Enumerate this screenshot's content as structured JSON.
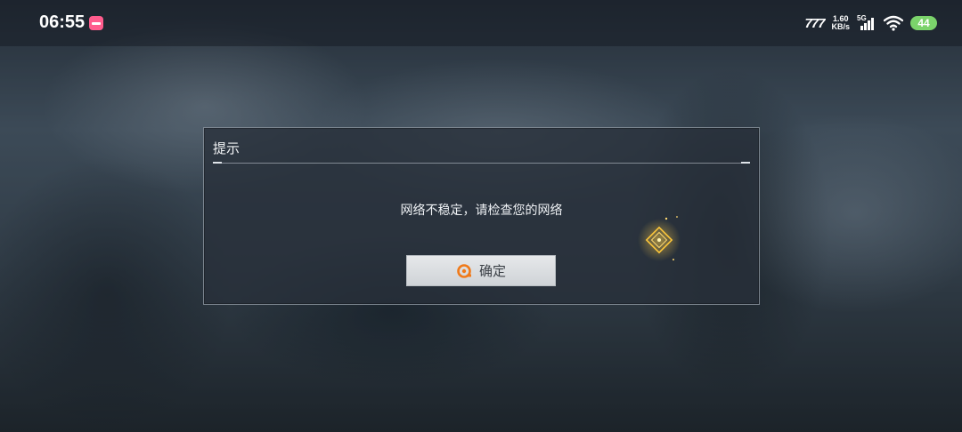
{
  "status_bar": {
    "time": "06:55",
    "carrier_logo": "777",
    "net_speed_value": "1.60",
    "net_speed_unit": "KB/s",
    "network_type": "5G",
    "battery_level": "44",
    "colors": {
      "battery": "#7bd36b",
      "app_icon": "#ff5c8d"
    }
  },
  "dialog": {
    "title": "提示",
    "message": "网络不稳定，请检查您的网络",
    "confirm_label": "确定",
    "colors": {
      "accent": "#f07a1a"
    }
  }
}
